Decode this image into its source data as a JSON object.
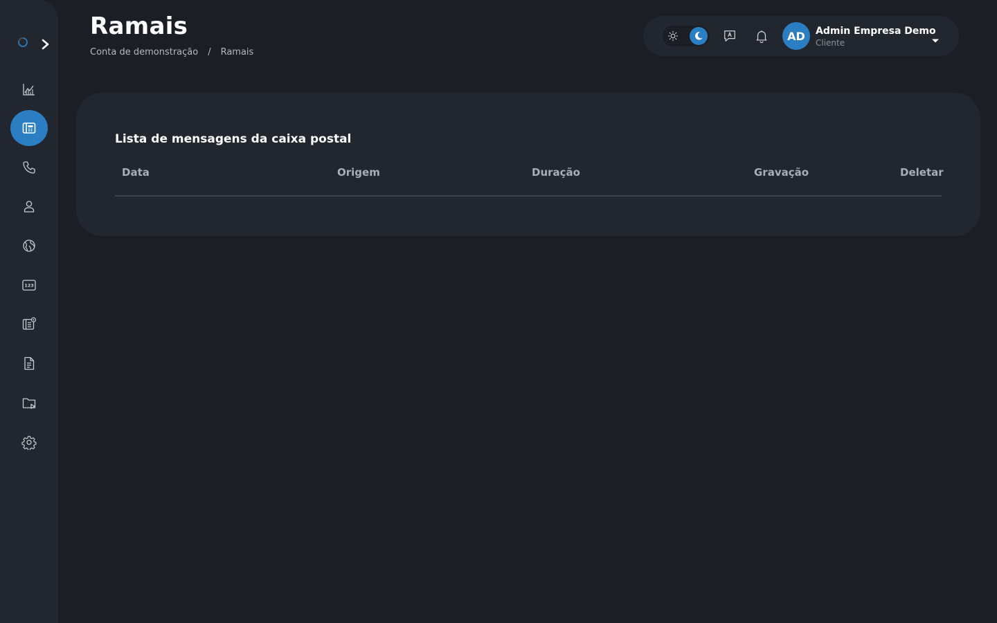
{
  "page": {
    "title": "Ramais",
    "breadcrumb": [
      "Conta de demonstração",
      "/",
      "Ramais"
    ]
  },
  "sidebar": {
    "items": [
      {
        "icon": "chart-icon",
        "active": false
      },
      {
        "icon": "extensions-icon",
        "active": true
      },
      {
        "icon": "phone-icon",
        "active": false
      },
      {
        "icon": "user-icon",
        "active": false
      },
      {
        "icon": "globe-icon",
        "active": false
      },
      {
        "icon": "numbers-icon",
        "active": false
      },
      {
        "icon": "voicemail-icon",
        "active": false
      },
      {
        "icon": "document-icon",
        "active": false
      },
      {
        "icon": "folder-play-icon",
        "active": false
      },
      {
        "icon": "gear-icon",
        "active": false
      }
    ]
  },
  "topbar": {
    "theme": "dark",
    "user": {
      "initials": "AD",
      "name": "Admin Empresa Demo",
      "role": "Cliente"
    }
  },
  "card": {
    "title": "Lista de mensagens da caixa postal",
    "columns": [
      "Data",
      "Origem",
      "Duração",
      "Gravação",
      "Deletar"
    ],
    "rows": []
  },
  "colors": {
    "accent": "#2b7ec1",
    "background": "#1b1e25",
    "surface": "#22272f"
  }
}
